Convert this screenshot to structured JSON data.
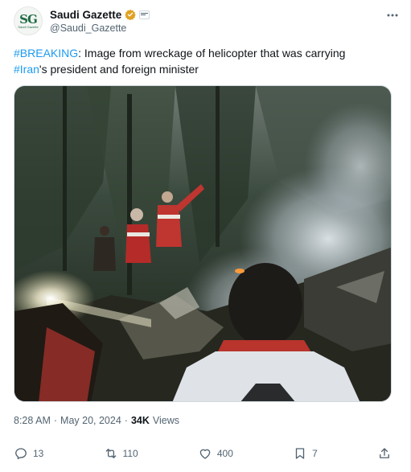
{
  "account": {
    "display_name": "Saudi Gazette",
    "handle": "@Saudi_Gazette",
    "avatar_logo": "SG",
    "avatar_sub": "Saudi Gazette",
    "verified_icon": "verified-badge-icon",
    "affiliation_badge": "affiliation-badge-icon"
  },
  "tweet": {
    "hashtag1": "#BREAKING",
    "text1": ": Image from wreckage of helicopter that was carrying",
    "hashtag2": "#Iran",
    "text2": "'s president and foreign minister"
  },
  "meta": {
    "time": "8:28 AM",
    "separator": "·",
    "date": "May 20, 2024",
    "separator2": "·",
    "views_count": "34K",
    "views_label": "Views"
  },
  "actions": {
    "replies": "13",
    "reposts": "110",
    "likes": "400",
    "bookmarks": "7"
  },
  "colors": {
    "link": "#1d9bf0",
    "text": "#0f1419",
    "secondary": "#536471",
    "verified": "#e0a220"
  }
}
